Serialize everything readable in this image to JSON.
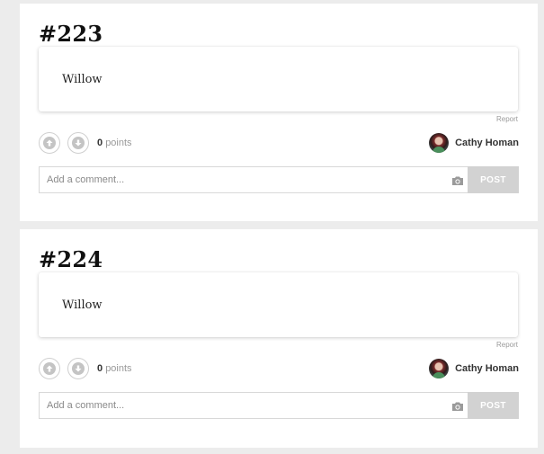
{
  "posts": [
    {
      "number": "#223",
      "answer": "Willow",
      "report_label": "Report",
      "points_value": "0",
      "points_label": "points",
      "author": "Cathy Homan",
      "comment_placeholder": "Add a comment...",
      "post_label": "POST"
    },
    {
      "number": "#224",
      "answer": "Willow",
      "report_label": "Report",
      "points_value": "0",
      "points_label": "points",
      "author": "Cathy Homan",
      "comment_placeholder": "Add a comment...",
      "post_label": "POST"
    }
  ],
  "icons": {
    "upvote": "arrow-up-icon",
    "downvote": "arrow-down-icon",
    "camera": "camera-icon"
  },
  "colors": {
    "page_background": "#ececec",
    "card_background": "#ffffff",
    "post_button": "#d2d2d2",
    "vote_icon": "#c4c4c4"
  }
}
